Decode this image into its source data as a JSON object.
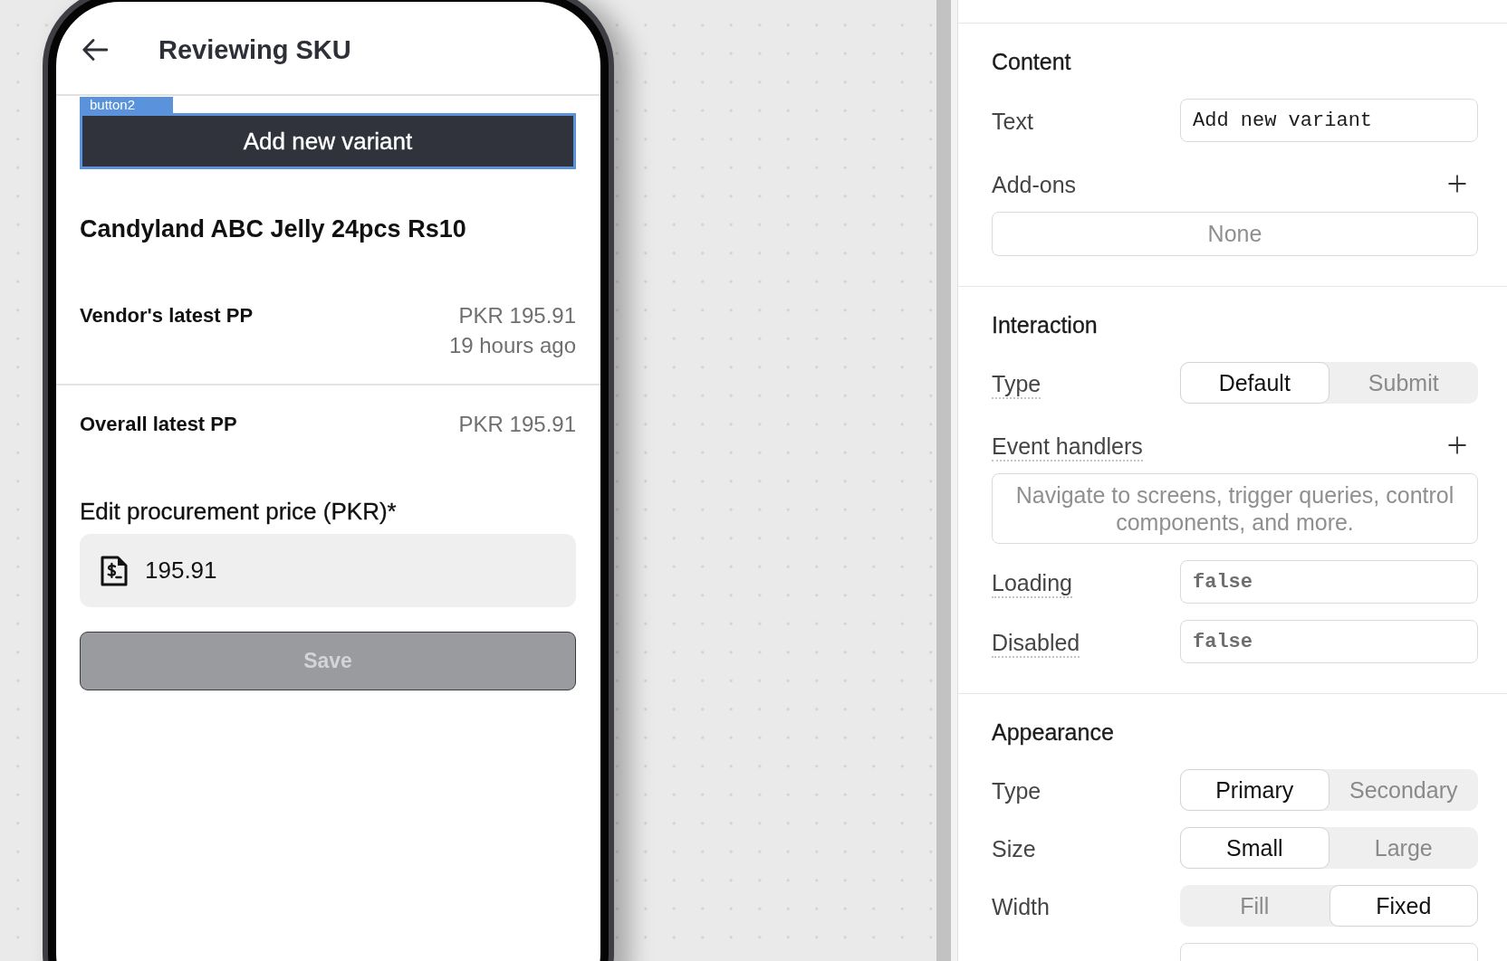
{
  "phone": {
    "title": "Reviewing SKU",
    "selected_button": {
      "tag": "button2",
      "label": "Add new variant",
      "selected": true
    },
    "product_name": "Candyland ABC Jelly 24pcs Rs10",
    "price_rows": [
      {
        "label": "Vendor's latest PP",
        "value": "PKR 195.91",
        "time": "19 hours ago"
      },
      {
        "label": "Overall latest PP",
        "value": "PKR 195.91"
      }
    ],
    "price_field": {
      "label": "Edit procurement price (PKR)*",
      "value": "195.91"
    },
    "save_button": {
      "label": "Save",
      "disabled": true
    }
  },
  "inspector": {
    "sections": [
      {
        "title": "Content",
        "rows": [
          {
            "kind": "input",
            "label": "Text",
            "hint": false,
            "value": "Add new variant"
          },
          {
            "kind": "list",
            "label": "Add-ons",
            "hint": false,
            "empty_text": "None"
          }
        ]
      },
      {
        "title": "Interaction",
        "rows": [
          {
            "kind": "segmented",
            "label": "Type",
            "hint": true,
            "options": [
              {
                "label": "Default",
                "selected": true
              },
              {
                "label": "Submit",
                "selected": false
              }
            ]
          },
          {
            "kind": "list",
            "label": "Event handlers",
            "hint": true,
            "empty_text": "Navigate to screens, trigger queries, control components, and more."
          },
          {
            "kind": "code",
            "label": "Loading",
            "hint": true,
            "value": "false"
          },
          {
            "kind": "code",
            "label": "Disabled",
            "hint": true,
            "value": "false"
          }
        ]
      },
      {
        "title": "Appearance",
        "rows": [
          {
            "kind": "segmented",
            "label": "Type",
            "hint": false,
            "options": [
              {
                "label": "Primary",
                "selected": true
              },
              {
                "label": "Secondary",
                "selected": false
              }
            ]
          },
          {
            "kind": "segmented",
            "label": "Size",
            "hint": false,
            "options": [
              {
                "label": "Small",
                "selected": true
              },
              {
                "label": "Large",
                "selected": false
              }
            ]
          },
          {
            "kind": "segmented",
            "label": "Width",
            "hint": false,
            "options": [
              {
                "label": "Fill",
                "selected": false
              },
              {
                "label": "Fixed",
                "selected": true
              }
            ]
          },
          {
            "kind": "code"
          }
        ]
      }
    ]
  }
}
